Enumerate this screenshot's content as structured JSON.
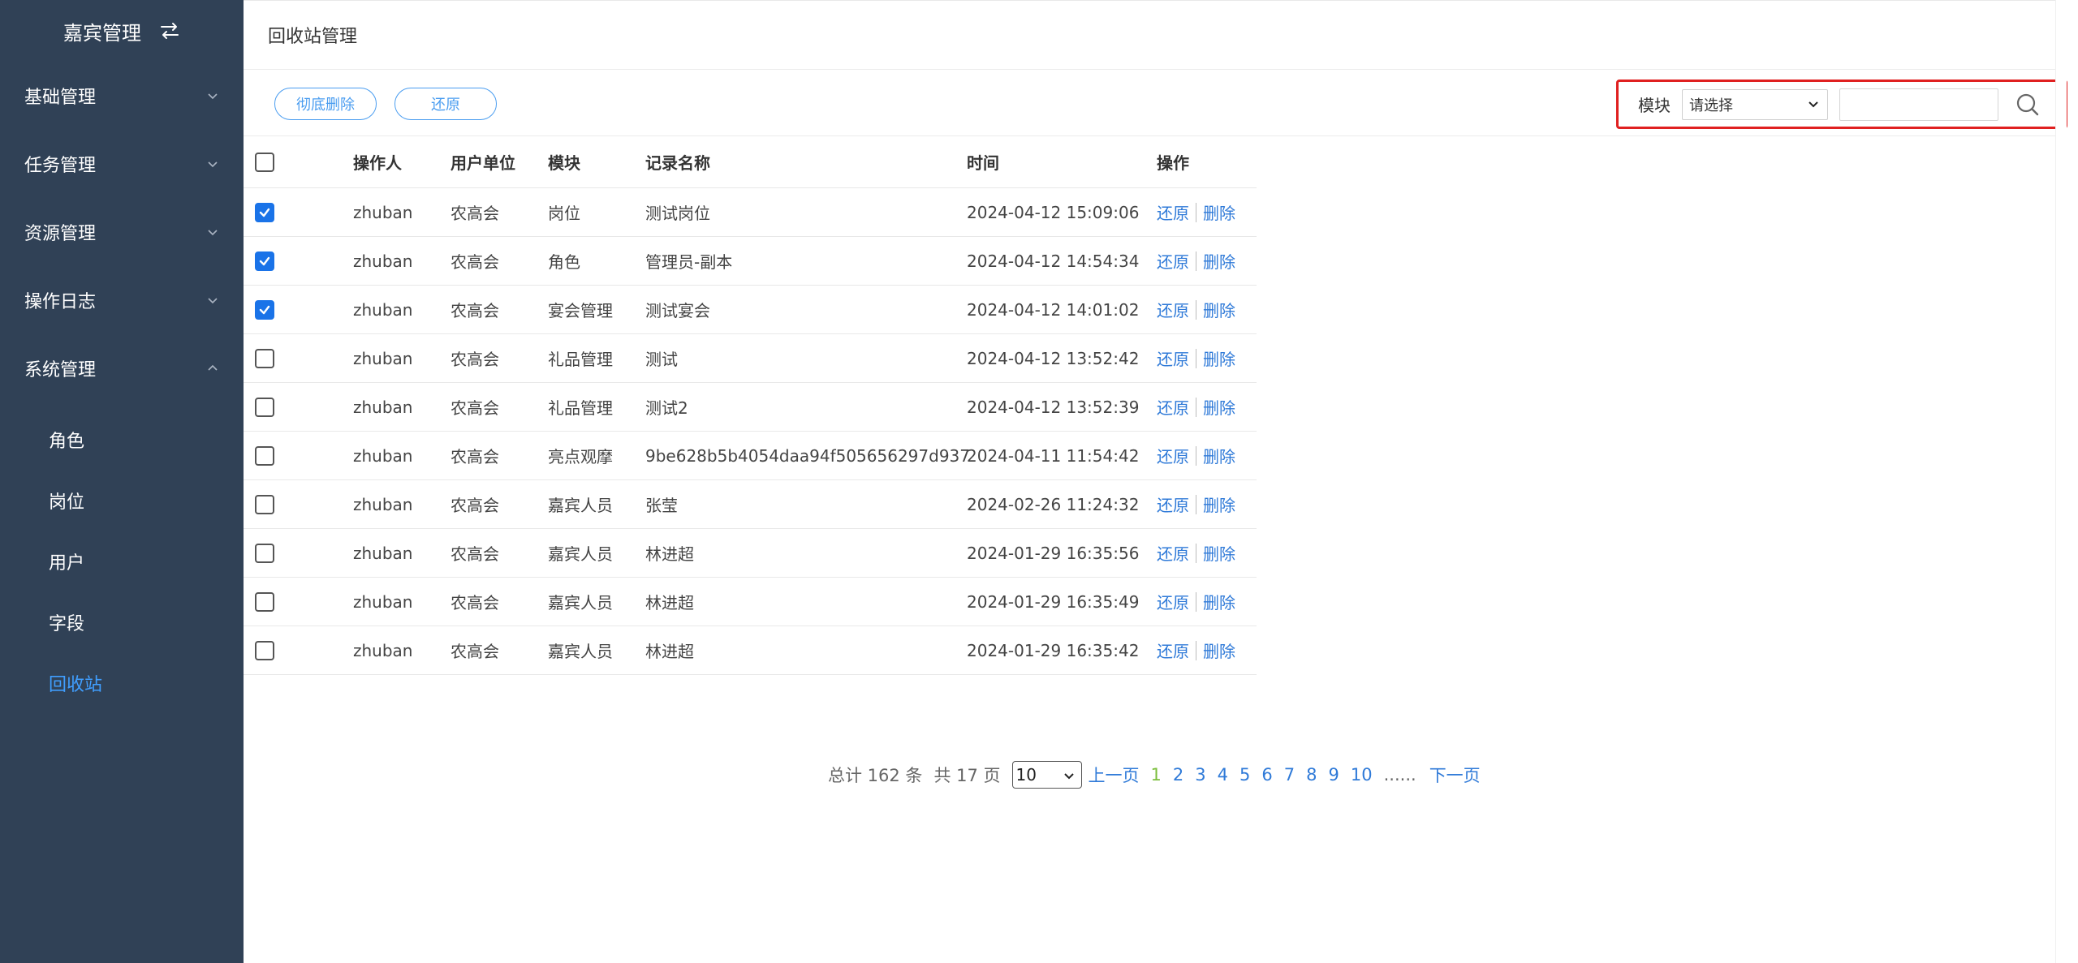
{
  "sidebar": {
    "title": "嘉宾管理",
    "menus": [
      {
        "label": "基础管理"
      },
      {
        "label": "任务管理"
      },
      {
        "label": "资源管理"
      },
      {
        "label": "操作日志"
      },
      {
        "label": "系统管理"
      }
    ],
    "subitems": [
      {
        "label": "角色"
      },
      {
        "label": "岗位"
      },
      {
        "label": "用户"
      },
      {
        "label": "字段"
      },
      {
        "label": "回收站"
      }
    ],
    "active_color": "#409eff",
    "bg_color": "#304156"
  },
  "page": {
    "title": "回收站管理"
  },
  "toolbar": {
    "delete_label": "彻底删除",
    "restore_label": "还原"
  },
  "filter": {
    "label": "模块",
    "select_value": "请选择",
    "search_value": ""
  },
  "table": {
    "headers": {
      "operator": "操作人",
      "unit": "用户单位",
      "module": "模块",
      "name": "记录名称",
      "time": "时间",
      "action": "操作"
    },
    "action_restore": "还原",
    "action_delete": "删除",
    "rows": [
      {
        "checked": true,
        "operator": "zhuban",
        "unit": "农高会",
        "module": "岗位",
        "name": "测试岗位",
        "time": "2024-04-12 15:09:06"
      },
      {
        "checked": true,
        "operator": "zhuban",
        "unit": "农高会",
        "module": "角色",
        "name": "管理员-副本",
        "time": "2024-04-12 14:54:34"
      },
      {
        "checked": true,
        "operator": "zhuban",
        "unit": "农高会",
        "module": "宴会管理",
        "name": "测试宴会",
        "time": "2024-04-12 14:01:02"
      },
      {
        "checked": false,
        "operator": "zhuban",
        "unit": "农高会",
        "module": "礼品管理",
        "name": "测试",
        "time": "2024-04-12 13:52:42"
      },
      {
        "checked": false,
        "operator": "zhuban",
        "unit": "农高会",
        "module": "礼品管理",
        "name": "测试2",
        "time": "2024-04-12 13:52:39"
      },
      {
        "checked": false,
        "operator": "zhuban",
        "unit": "农高会",
        "module": "亮点观摩",
        "name": "9be628b5b4054daa94f505656297d937",
        "time": "2024-04-11 11:54:42"
      },
      {
        "checked": false,
        "operator": "zhuban",
        "unit": "农高会",
        "module": "嘉宾人员",
        "name": "张莹",
        "time": "2024-02-26 11:24:32"
      },
      {
        "checked": false,
        "operator": "zhuban",
        "unit": "农高会",
        "module": "嘉宾人员",
        "name": "林进超",
        "time": "2024-01-29 16:35:56"
      },
      {
        "checked": false,
        "operator": "zhuban",
        "unit": "农高会",
        "module": "嘉宾人员",
        "name": "林进超",
        "time": "2024-01-29 16:35:49"
      },
      {
        "checked": false,
        "operator": "zhuban",
        "unit": "农高会",
        "module": "嘉宾人员",
        "name": "林进超",
        "time": "2024-01-29 16:35:42"
      }
    ]
  },
  "pagination": {
    "total_text": "总计 162 条",
    "pages_text": "共 17 页",
    "page_size": "10",
    "prev": "上一页",
    "pages": [
      "1",
      "2",
      "3",
      "4",
      "5",
      "6",
      "7",
      "8",
      "9",
      "10"
    ],
    "current": "1",
    "ellipsis": "......",
    "next": "下一页"
  }
}
